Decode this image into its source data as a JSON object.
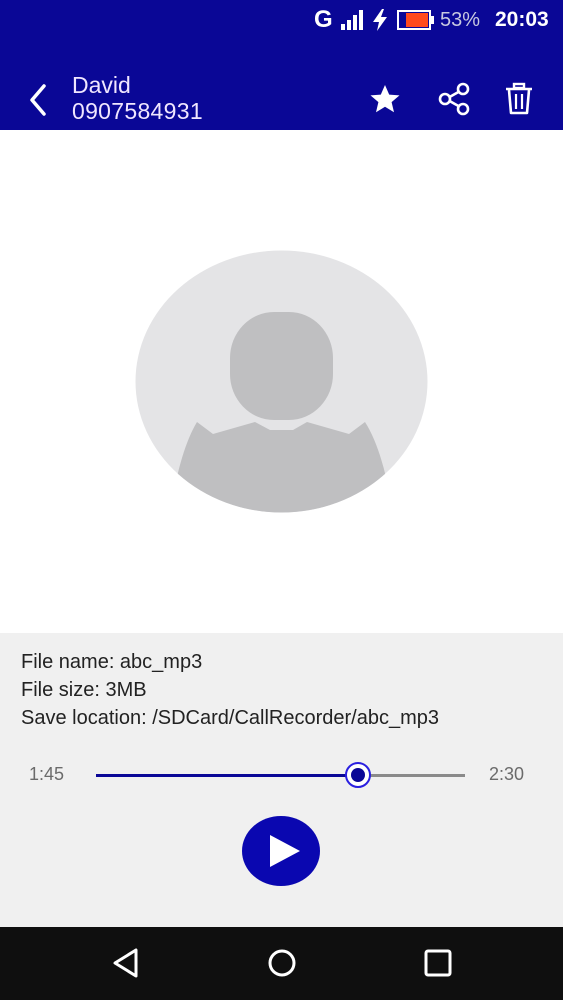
{
  "status_bar": {
    "network": "G",
    "battery_percent": "53%",
    "time": "20:03",
    "icons": [
      "signal-icon",
      "charging-icon",
      "battery-icon"
    ]
  },
  "toolbar": {
    "contact_name": "David",
    "contact_number": "0907584931",
    "icons": [
      "back-arrow-icon",
      "star-icon",
      "share-icon",
      "trash-icon"
    ]
  },
  "recording": {
    "file_name_line": "File name: abc_mp3",
    "file_size_line": "File size: 3MB",
    "save_location_line": "Save location: /SDCard/CallRecorder/abc_mp3"
  },
  "player": {
    "current_time": "1:45",
    "total_time": "2:30",
    "progress_fraction": 0.71
  },
  "nav_bar": {
    "icons": [
      "nav-back-icon",
      "nav-home-icon",
      "nav-recents-icon"
    ]
  },
  "colors": {
    "accent": "#0a0796",
    "panel_background": "#f0f0f0",
    "avatar_circle": "#e4e4e6",
    "avatar_silhouette": "#bfbfc1"
  }
}
